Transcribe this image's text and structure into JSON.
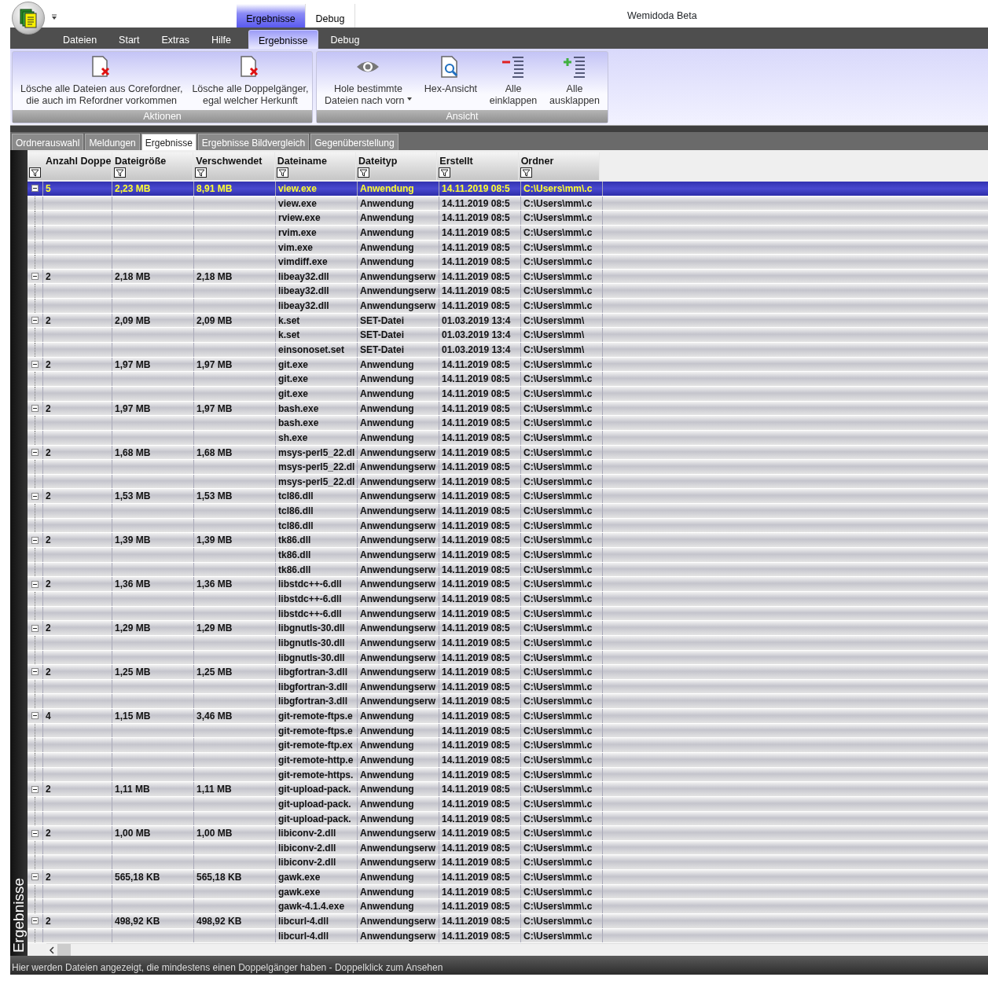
{
  "app": {
    "title": "Wemidoda Beta"
  },
  "contextual_tabs": [
    {
      "label": "Ergebnisse",
      "selected": true
    },
    {
      "label": "Debug",
      "selected": false
    }
  ],
  "ribbon_tabs": [
    {
      "label": "Dateien",
      "selected": false
    },
    {
      "label": "Start",
      "selected": false
    },
    {
      "label": "Extras",
      "selected": false
    },
    {
      "label": "Hilfe",
      "selected": false
    },
    {
      "label": "Ergebnisse",
      "selected": true
    },
    {
      "label": "Debug",
      "selected": false
    }
  ],
  "ribbon_groups": [
    {
      "title": "Aktionen",
      "buttons": [
        {
          "kind": "delete",
          "lines": [
            "Lösche alle Dateien aus Corefordner,",
            "die auch im Refordner vorkommen"
          ],
          "dropdown": false
        },
        {
          "kind": "delete",
          "lines": [
            "Lösche alle Doppelgänger,",
            "egal welcher Herkunft"
          ],
          "dropdown": false
        }
      ]
    },
    {
      "title": "Ansicht",
      "buttons": [
        {
          "kind": "eye",
          "lines": [
            "Hole bestimmte",
            "Dateien nach vorn"
          ],
          "dropdown": true
        },
        {
          "kind": "hex",
          "lines": [
            "Hex-Ansicht"
          ],
          "dropdown": false
        },
        {
          "kind": "collapse",
          "lines": [
            "Alle",
            "einklappen"
          ],
          "dropdown": false
        },
        {
          "kind": "expand",
          "lines": [
            "Alle",
            "ausklappen"
          ],
          "dropdown": false
        }
      ]
    }
  ],
  "document_tabs": [
    {
      "label": "Ordnerauswahl",
      "selected": false
    },
    {
      "label": "Meldungen",
      "selected": false
    },
    {
      "label": "Ergebnisse",
      "selected": true
    },
    {
      "label": "Ergebnisse Bildvergleich",
      "selected": false
    },
    {
      "label": "Gegenüberstellung",
      "selected": false
    }
  ],
  "side_panel": {
    "title": "Ergebnisse"
  },
  "table": {
    "columns": [
      "Anzahl Doppe",
      "Dateigröße",
      "Verschwendet",
      "Dateiname",
      "Dateityp",
      "Erstellt",
      "Ordner"
    ],
    "groups": [
      {
        "count": "5",
        "size": "2,23 MB",
        "wasted": "8,91 MB",
        "expanded": true,
        "selected": true,
        "files": [
          {
            "name": "view.exe",
            "type": "Anwendung",
            "created": "14.11.2019 08:5",
            "folder": "C:\\Users\\mm\\.c"
          },
          {
            "name": "view.exe",
            "type": "Anwendung",
            "created": "14.11.2019 08:5",
            "folder": "C:\\Users\\mm\\.c"
          },
          {
            "name": "rview.exe",
            "type": "Anwendung",
            "created": "14.11.2019 08:5",
            "folder": "C:\\Users\\mm\\.c"
          },
          {
            "name": "rvim.exe",
            "type": "Anwendung",
            "created": "14.11.2019 08:5",
            "folder": "C:\\Users\\mm\\.c"
          },
          {
            "name": "vim.exe",
            "type": "Anwendung",
            "created": "14.11.2019 08:5",
            "folder": "C:\\Users\\mm\\.c"
          },
          {
            "name": "vimdiff.exe",
            "type": "Anwendung",
            "created": "14.11.2019 08:5",
            "folder": "C:\\Users\\mm\\.c"
          }
        ]
      },
      {
        "count": "2",
        "size": "2,18 MB",
        "wasted": "2,18 MB",
        "expanded": true,
        "selected": false,
        "files": [
          {
            "name": "libeay32.dll",
            "type": "Anwendungserw",
            "created": "14.11.2019 08:5",
            "folder": "C:\\Users\\mm\\.c"
          },
          {
            "name": "libeay32.dll",
            "type": "Anwendungserw",
            "created": "14.11.2019 08:5",
            "folder": "C:\\Users\\mm\\.c"
          },
          {
            "name": "libeay32.dll",
            "type": "Anwendungserw",
            "created": "14.11.2019 08:5",
            "folder": "C:\\Users\\mm\\.c"
          }
        ]
      },
      {
        "count": "2",
        "size": "2,09 MB",
        "wasted": "2,09 MB",
        "expanded": true,
        "selected": false,
        "files": [
          {
            "name": "k.set",
            "type": "SET-Datei",
            "created": "01.03.2019 13:4",
            "folder": "C:\\Users\\mm\\"
          },
          {
            "name": "k.set",
            "type": "SET-Datei",
            "created": "01.03.2019 13:4",
            "folder": "C:\\Users\\mm\\"
          },
          {
            "name": "einsonoset.set",
            "type": "SET-Datei",
            "created": "01.03.2019 13:4",
            "folder": "C:\\Users\\mm\\"
          }
        ]
      },
      {
        "count": "2",
        "size": "1,97 MB",
        "wasted": "1,97 MB",
        "expanded": true,
        "selected": false,
        "files": [
          {
            "name": "git.exe",
            "type": "Anwendung",
            "created": "14.11.2019 08:5",
            "folder": "C:\\Users\\mm\\.c"
          },
          {
            "name": "git.exe",
            "type": "Anwendung",
            "created": "14.11.2019 08:5",
            "folder": "C:\\Users\\mm\\.c"
          },
          {
            "name": "git.exe",
            "type": "Anwendung",
            "created": "14.11.2019 08:5",
            "folder": "C:\\Users\\mm\\.c"
          }
        ]
      },
      {
        "count": "2",
        "size": "1,97 MB",
        "wasted": "1,97 MB",
        "expanded": true,
        "selected": false,
        "files": [
          {
            "name": "bash.exe",
            "type": "Anwendung",
            "created": "14.11.2019 08:5",
            "folder": "C:\\Users\\mm\\.c"
          },
          {
            "name": "bash.exe",
            "type": "Anwendung",
            "created": "14.11.2019 08:5",
            "folder": "C:\\Users\\mm\\.c"
          },
          {
            "name": "sh.exe",
            "type": "Anwendung",
            "created": "14.11.2019 08:5",
            "folder": "C:\\Users\\mm\\.c"
          }
        ]
      },
      {
        "count": "2",
        "size": "1,68 MB",
        "wasted": "1,68 MB",
        "expanded": true,
        "selected": false,
        "files": [
          {
            "name": "msys-perl5_22.dl",
            "type": "Anwendungserw",
            "created": "14.11.2019 08:5",
            "folder": "C:\\Users\\mm\\.c"
          },
          {
            "name": "msys-perl5_22.dl",
            "type": "Anwendungserw",
            "created": "14.11.2019 08:5",
            "folder": "C:\\Users\\mm\\.c"
          },
          {
            "name": "msys-perl5_22.dl",
            "type": "Anwendungserw",
            "created": "14.11.2019 08:5",
            "folder": "C:\\Users\\mm\\.c"
          }
        ]
      },
      {
        "count": "2",
        "size": "1,53 MB",
        "wasted": "1,53 MB",
        "expanded": true,
        "selected": false,
        "files": [
          {
            "name": "tcl86.dll",
            "type": "Anwendungserw",
            "created": "14.11.2019 08:5",
            "folder": "C:\\Users\\mm\\.c"
          },
          {
            "name": "tcl86.dll",
            "type": "Anwendungserw",
            "created": "14.11.2019 08:5",
            "folder": "C:\\Users\\mm\\.c"
          },
          {
            "name": "tcl86.dll",
            "type": "Anwendungserw",
            "created": "14.11.2019 08:5",
            "folder": "C:\\Users\\mm\\.c"
          }
        ]
      },
      {
        "count": "2",
        "size": "1,39 MB",
        "wasted": "1,39 MB",
        "expanded": true,
        "selected": false,
        "files": [
          {
            "name": "tk86.dll",
            "type": "Anwendungserw",
            "created": "14.11.2019 08:5",
            "folder": "C:\\Users\\mm\\.c"
          },
          {
            "name": "tk86.dll",
            "type": "Anwendungserw",
            "created": "14.11.2019 08:5",
            "folder": "C:\\Users\\mm\\.c"
          },
          {
            "name": "tk86.dll",
            "type": "Anwendungserw",
            "created": "14.11.2019 08:5",
            "folder": "C:\\Users\\mm\\.c"
          }
        ]
      },
      {
        "count": "2",
        "size": "1,36 MB",
        "wasted": "1,36 MB",
        "expanded": true,
        "selected": false,
        "files": [
          {
            "name": "libstdc++-6.dll",
            "type": "Anwendungserw",
            "created": "14.11.2019 08:5",
            "folder": "C:\\Users\\mm\\.c"
          },
          {
            "name": "libstdc++-6.dll",
            "type": "Anwendungserw",
            "created": "14.11.2019 08:5",
            "folder": "C:\\Users\\mm\\.c"
          },
          {
            "name": "libstdc++-6.dll",
            "type": "Anwendungserw",
            "created": "14.11.2019 08:5",
            "folder": "C:\\Users\\mm\\.c"
          }
        ]
      },
      {
        "count": "2",
        "size": "1,29 MB",
        "wasted": "1,29 MB",
        "expanded": true,
        "selected": false,
        "files": [
          {
            "name": "libgnutls-30.dll",
            "type": "Anwendungserw",
            "created": "14.11.2019 08:5",
            "folder": "C:\\Users\\mm\\.c"
          },
          {
            "name": "libgnutls-30.dll",
            "type": "Anwendungserw",
            "created": "14.11.2019 08:5",
            "folder": "C:\\Users\\mm\\.c"
          },
          {
            "name": "libgnutls-30.dll",
            "type": "Anwendungserw",
            "created": "14.11.2019 08:5",
            "folder": "C:\\Users\\mm\\.c"
          }
        ]
      },
      {
        "count": "2",
        "size": "1,25 MB",
        "wasted": "1,25 MB",
        "expanded": true,
        "selected": false,
        "files": [
          {
            "name": "libgfortran-3.dll",
            "type": "Anwendungserw",
            "created": "14.11.2019 08:5",
            "folder": "C:\\Users\\mm\\.c"
          },
          {
            "name": "libgfortran-3.dll",
            "type": "Anwendungserw",
            "created": "14.11.2019 08:5",
            "folder": "C:\\Users\\mm\\.c"
          },
          {
            "name": "libgfortran-3.dll",
            "type": "Anwendungserw",
            "created": "14.11.2019 08:5",
            "folder": "C:\\Users\\mm\\.c"
          }
        ]
      },
      {
        "count": "4",
        "size": "1,15 MB",
        "wasted": "3,46 MB",
        "expanded": true,
        "selected": false,
        "files": [
          {
            "name": "git-remote-ftps.e",
            "type": "Anwendung",
            "created": "14.11.2019 08:5",
            "folder": "C:\\Users\\mm\\.c"
          },
          {
            "name": "git-remote-ftps.e",
            "type": "Anwendung",
            "created": "14.11.2019 08:5",
            "folder": "C:\\Users\\mm\\.c"
          },
          {
            "name": "git-remote-ftp.ex",
            "type": "Anwendung",
            "created": "14.11.2019 08:5",
            "folder": "C:\\Users\\mm\\.c"
          },
          {
            "name": "git-remote-http.e",
            "type": "Anwendung",
            "created": "14.11.2019 08:5",
            "folder": "C:\\Users\\mm\\.c"
          },
          {
            "name": "git-remote-https.",
            "type": "Anwendung",
            "created": "14.11.2019 08:5",
            "folder": "C:\\Users\\mm\\.c"
          }
        ]
      },
      {
        "count": "2",
        "size": "1,11 MB",
        "wasted": "1,11 MB",
        "expanded": true,
        "selected": false,
        "files": [
          {
            "name": "git-upload-pack.",
            "type": "Anwendung",
            "created": "14.11.2019 08:5",
            "folder": "C:\\Users\\mm\\.c"
          },
          {
            "name": "git-upload-pack.",
            "type": "Anwendung",
            "created": "14.11.2019 08:5",
            "folder": "C:\\Users\\mm\\.c"
          },
          {
            "name": "git-upload-pack.",
            "type": "Anwendung",
            "created": "14.11.2019 08:5",
            "folder": "C:\\Users\\mm\\.c"
          }
        ]
      },
      {
        "count": "2",
        "size": "1,00 MB",
        "wasted": "1,00 MB",
        "expanded": true,
        "selected": false,
        "files": [
          {
            "name": "libiconv-2.dll",
            "type": "Anwendungserw",
            "created": "14.11.2019 08:5",
            "folder": "C:\\Users\\mm\\.c"
          },
          {
            "name": "libiconv-2.dll",
            "type": "Anwendungserw",
            "created": "14.11.2019 08:5",
            "folder": "C:\\Users\\mm\\.c"
          },
          {
            "name": "libiconv-2.dll",
            "type": "Anwendungserw",
            "created": "14.11.2019 08:5",
            "folder": "C:\\Users\\mm\\.c"
          }
        ]
      },
      {
        "count": "2",
        "size": "565,18 KB",
        "wasted": "565,18 KB",
        "expanded": true,
        "selected": false,
        "files": [
          {
            "name": "gawk.exe",
            "type": "Anwendung",
            "created": "14.11.2019 08:5",
            "folder": "C:\\Users\\mm\\.c"
          },
          {
            "name": "gawk.exe",
            "type": "Anwendung",
            "created": "14.11.2019 08:5",
            "folder": "C:\\Users\\mm\\.c"
          },
          {
            "name": "gawk-4.1.4.exe",
            "type": "Anwendung",
            "created": "14.11.2019 08:5",
            "folder": "C:\\Users\\mm\\.c"
          }
        ]
      },
      {
        "count": "2",
        "size": "498,92 KB",
        "wasted": "498,92 KB",
        "expanded": true,
        "selected": false,
        "files": [
          {
            "name": "libcurl-4.dll",
            "type": "Anwendungserw",
            "created": "14.11.2019 08:5",
            "folder": "C:\\Users\\mm\\.c"
          },
          {
            "name": "libcurl-4.dll",
            "type": "Anwendungserw",
            "created": "14.11.2019 08:5",
            "folder": "C:\\Users\\mm\\.c"
          }
        ]
      }
    ]
  },
  "status_bar": {
    "text": "Hier werden Dateien angezeigt, die mindestens einen Doppelgänger haben - Doppelklick zum Ansehen"
  }
}
